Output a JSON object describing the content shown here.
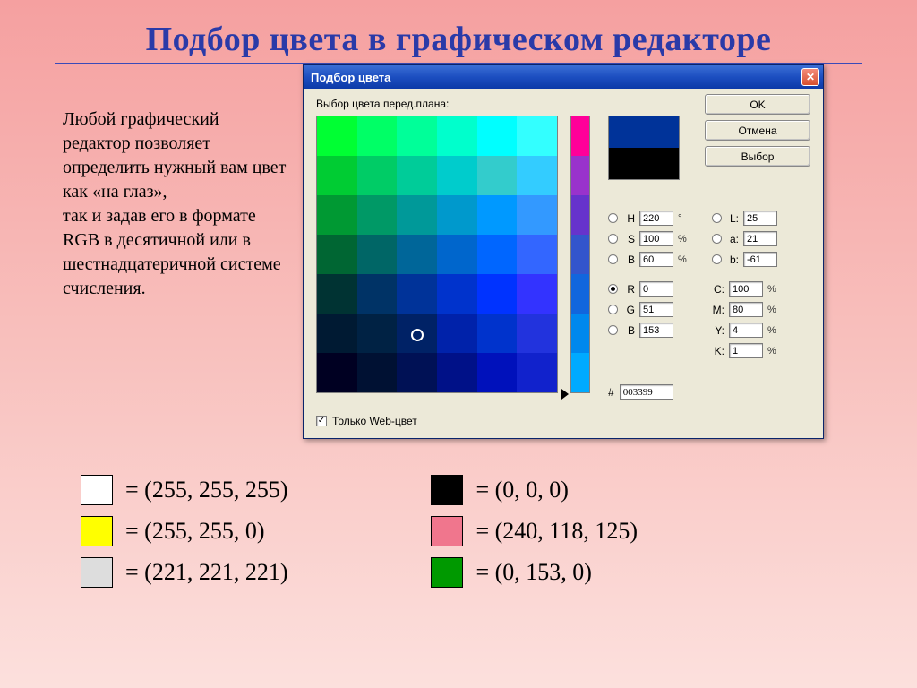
{
  "slide": {
    "title": "Подбор цвета в графическом редакторе",
    "body": "Любой графический редактор позволяет определить нужный вам цвет как «на глаз»,\nтак и задав его в формате\nRGB в десятичной или в шестнадцатеричной системе счисления."
  },
  "dialog": {
    "title": "Подбор цвета",
    "field_label": "Выбор цвета перед.плана:",
    "buttons": {
      "ok": "OK",
      "cancel": "Отмена",
      "select": "Выбор"
    },
    "values": {
      "H": "220",
      "S": "100",
      "Bv": "60",
      "L": "25",
      "a": "21",
      "b": "-61",
      "R": "0",
      "G": "51",
      "B": "153",
      "C": "100",
      "M": "80",
      "Y": "4",
      "K": "1",
      "hex": "003399"
    },
    "labels": {
      "H": "H",
      "S": "S",
      "Bv": "B",
      "L": "L:",
      "a": "a:",
      "b": "b:",
      "R": "R",
      "G": "G",
      "B": "B",
      "C": "C:",
      "M": "M:",
      "Y": "Y:",
      "K": "K:",
      "hash": "#"
    },
    "web_only_label": "Только Web-цвет",
    "web_only_checked": true,
    "degree": "°",
    "percent": "%"
  },
  "palette_colors": [
    "#00ff33",
    "#00ff66",
    "#00ff99",
    "#00ffcc",
    "#00ffff",
    "#33ffff",
    "#00cc33",
    "#00cc66",
    "#00cc99",
    "#00cccc",
    "#33cccc",
    "#33ccff",
    "#009933",
    "#009966",
    "#009999",
    "#0099cc",
    "#0099ff",
    "#3399ff",
    "#006633",
    "#006666",
    "#006699",
    "#0066cc",
    "#0066ff",
    "#3366ff",
    "#003333",
    "#003366",
    "#003399",
    "#0033cc",
    "#0033ff",
    "#3333ff",
    "#001a33",
    "#002244",
    "#002266",
    "#0022aa",
    "#0033cc",
    "#2233dd",
    "#000022",
    "#001133",
    "#001155",
    "#001188",
    "#0011bb",
    "#1122cc"
  ],
  "hue_colors": [
    "#ff0099",
    "#9933cc",
    "#6633cc",
    "#3355cc",
    "#1166dd",
    "#0088ee",
    "#00aaff"
  ],
  "samples": {
    "left": [
      {
        "color": "#ffffff",
        "text": "= (255, 255, 255)"
      },
      {
        "color": "#ffff00",
        "text": "= (255, 255, 0)"
      },
      {
        "color": "#dddddd",
        "text": "= (221, 221, 221)"
      }
    ],
    "right": [
      {
        "color": "#000000",
        "text": "= (0, 0, 0)"
      },
      {
        "color": "#f0768d",
        "text": "= (240, 118, 125)"
      },
      {
        "color": "#009900",
        "text": "= (0, 153, 0)"
      }
    ]
  }
}
